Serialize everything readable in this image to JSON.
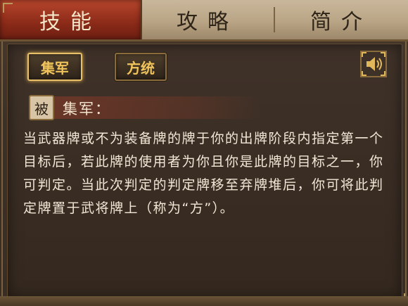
{
  "tabs": {
    "skill": "技能",
    "strategy": "攻略",
    "intro": "简介"
  },
  "skill_buttons": {
    "jijun": "集军",
    "fangtong": "方统"
  },
  "skill_detail": {
    "badge": "被",
    "name": "集军：",
    "description": "当武器牌或不为装备牌的牌于你的出牌阶段内指定第一个目标后，若此牌的使用者为你且你是此牌的目标之一，你可判定。当此次判定的判定牌移至弃牌堆后，你可将此判定牌置于武将牌上（称为“方”）。"
  },
  "icons": {
    "speaker": "speaker-icon"
  },
  "colors": {
    "active_tab": "#8a2a18",
    "tab_bar": "#b9a585",
    "skill_button_text": "#f0c45a",
    "description_text": "#f1e7d6"
  }
}
